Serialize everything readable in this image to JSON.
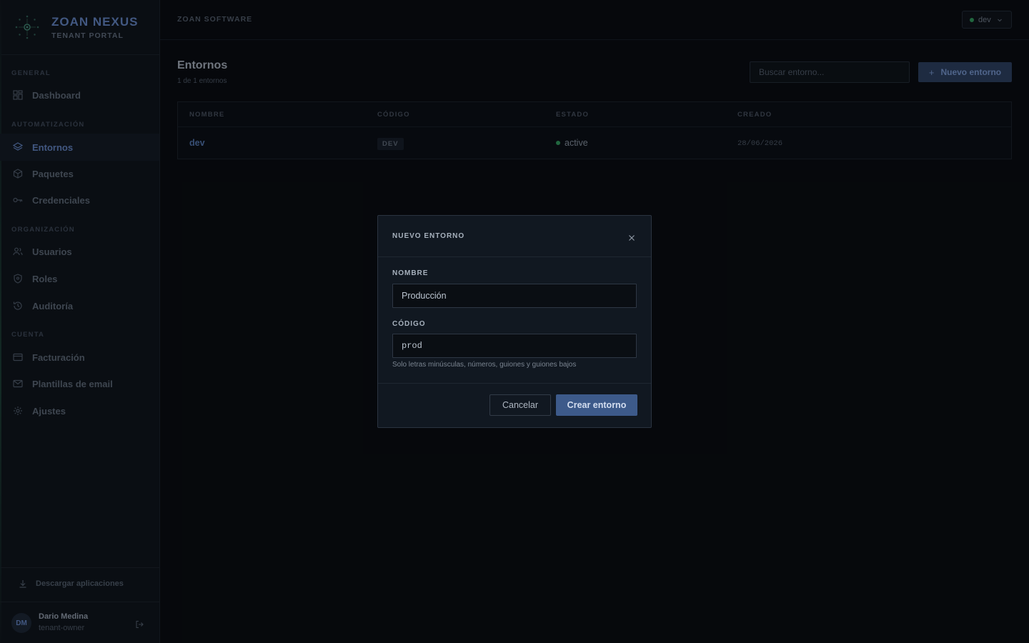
{
  "brand": {
    "name": "ZOAN NEXUS",
    "subtitle": "TENANT PORTAL"
  },
  "sidebar": {
    "sections": {
      "general": "GENERAL",
      "automation": "AUTOMATIZACIÓN",
      "organization": "ORGANIZACIÓN",
      "account": "CUENTA"
    },
    "items": {
      "dashboard": "Dashboard",
      "environments": "Entornos",
      "packages": "Paquetes",
      "credentials": "Credenciales",
      "users": "Usuarios",
      "roles": "Roles",
      "audit": "Auditoría",
      "billing": "Facturación",
      "email_templates": "Plantillas de email",
      "settings": "Ajustes"
    },
    "active_item": "Entornos",
    "download_label": "Descargar aplicaciones",
    "user": {
      "initials": "DM",
      "name": "Dario Medina",
      "role": "tenant-owner"
    }
  },
  "topbar": {
    "org_name": "ZOAN SOFTWARE",
    "env_selector": {
      "value": "dev",
      "status_color": "#2e8f58"
    }
  },
  "page": {
    "title": "Entornos",
    "count_text": "1 de 1 entornos",
    "search_placeholder": "Buscar entorno...",
    "new_button_label": "Nuevo entorno",
    "new_button_icon": "plus-icon"
  },
  "table": {
    "columns": [
      "NOMBRE",
      "CÓDIGO",
      "ESTADO",
      "CREADO"
    ],
    "rows": [
      {
        "name": "dev",
        "code": "DEV",
        "status": "active",
        "created": "28/06/2026"
      }
    ]
  },
  "modal": {
    "title": "NUEVO ENTORNO",
    "name_label": "NOMBRE",
    "name_value": "Producción",
    "code_label": "CÓDIGO",
    "code_value": "prod",
    "code_hint": "Solo letras minúsculas, números, guiones y guiones bajos",
    "cancel_label": "Cancelar",
    "submit_label": "Crear entorno"
  },
  "colors": {
    "accent": "#5c7bb4",
    "primary_button": "#3d5a8a",
    "status_active": "#2e8f58",
    "background": "#090c11"
  }
}
